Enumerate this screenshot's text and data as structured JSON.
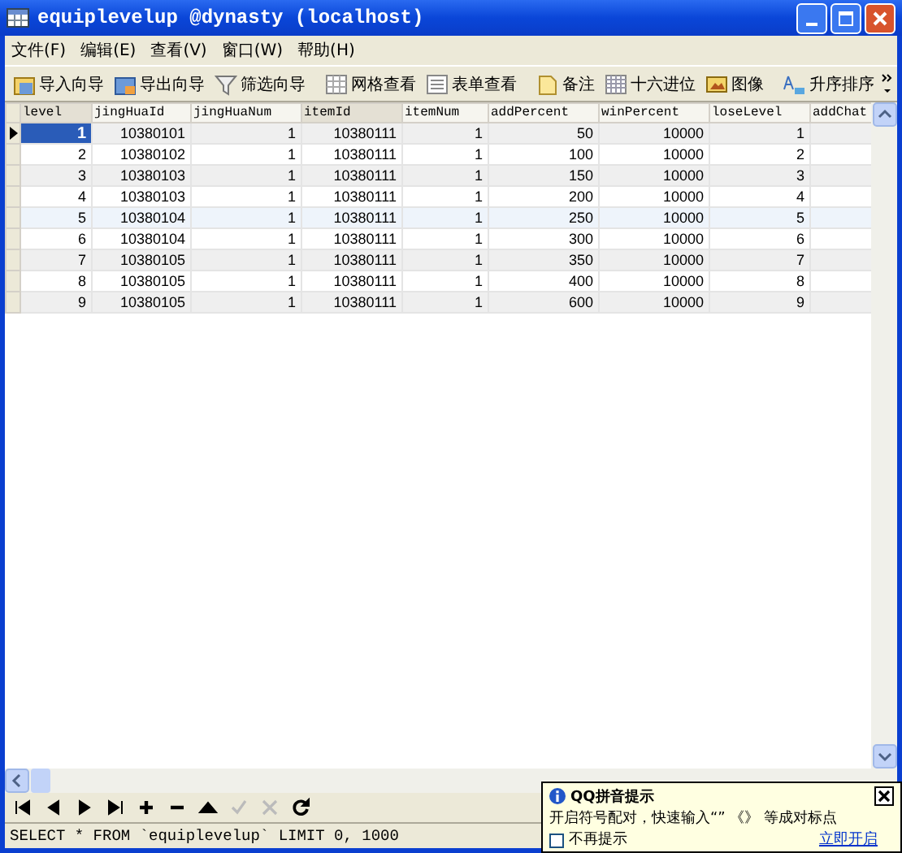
{
  "window": {
    "title": "equiplevelup @dynasty (localhost)"
  },
  "menu": [
    "文件(F)",
    "编辑(E)",
    "查看(V)",
    "窗口(W)",
    "帮助(H)"
  ],
  "toolbar": [
    {
      "kind": "import",
      "label": "导入向导"
    },
    {
      "kind": "export",
      "label": "导出向导"
    },
    {
      "kind": "filter",
      "label": "筛选向导"
    },
    {
      "kind": "grid",
      "label": "网格查看"
    },
    {
      "kind": "form",
      "label": "表单查看"
    },
    {
      "kind": "memo",
      "label": "备注"
    },
    {
      "kind": "hex",
      "label": "十六进位"
    },
    {
      "kind": "image",
      "label": "图像"
    },
    {
      "kind": "sort",
      "label": "升序排序"
    }
  ],
  "table": {
    "columns": [
      "level",
      "jingHuaId",
      "jingHuaNum",
      "itemId",
      "itemNum",
      "addPercent",
      "winPercent",
      "loseLevel",
      "addChat"
    ],
    "rows": [
      {
        "selected": true,
        "cells": [
          "1",
          "10380101",
          "1",
          "10380111",
          "1",
          "50",
          "10000",
          "1",
          ""
        ]
      },
      {
        "selected": false,
        "cells": [
          "2",
          "10380102",
          "1",
          "10380111",
          "1",
          "100",
          "10000",
          "2",
          ""
        ]
      },
      {
        "selected": false,
        "cells": [
          "3",
          "10380103",
          "1",
          "10380111",
          "1",
          "150",
          "10000",
          "3",
          ""
        ]
      },
      {
        "selected": false,
        "cells": [
          "4",
          "10380103",
          "1",
          "10380111",
          "1",
          "200",
          "10000",
          "4",
          ""
        ]
      },
      {
        "selected": false,
        "cells": [
          "5",
          "10380104",
          "1",
          "10380111",
          "1",
          "250",
          "10000",
          "5",
          ""
        ]
      },
      {
        "selected": false,
        "cells": [
          "6",
          "10380104",
          "1",
          "10380111",
          "1",
          "300",
          "10000",
          "6",
          ""
        ]
      },
      {
        "selected": false,
        "cells": [
          "7",
          "10380105",
          "1",
          "10380111",
          "1",
          "350",
          "10000",
          "7",
          ""
        ]
      },
      {
        "selected": false,
        "cells": [
          "8",
          "10380105",
          "1",
          "10380111",
          "1",
          "400",
          "10000",
          "8",
          ""
        ]
      },
      {
        "selected": false,
        "cells": [
          "9",
          "10380105",
          "1",
          "10380111",
          "1",
          "600",
          "10000",
          "9",
          ""
        ]
      }
    ]
  },
  "navigator": [
    {
      "kind": "first",
      "disabled": false
    },
    {
      "kind": "prev",
      "disabled": false
    },
    {
      "kind": "next",
      "disabled": false
    },
    {
      "kind": "last",
      "disabled": false
    },
    {
      "kind": "add",
      "disabled": false
    },
    {
      "kind": "delete",
      "disabled": false
    },
    {
      "kind": "up",
      "disabled": false
    },
    {
      "kind": "apply",
      "disabled": true
    },
    {
      "kind": "cancel",
      "disabled": true
    },
    {
      "kind": "refresh",
      "disabled": false
    }
  ],
  "status_bar": "SELECT * FROM `equiplevelup` LIMIT 0, 1000",
  "popup": {
    "title": "QQ拼音提示",
    "message": "开启符号配对，快速输入“” 《》 等成对标点",
    "checkbox": {
      "label": "不再提示",
      "checked": false
    },
    "link": "立即开启"
  }
}
